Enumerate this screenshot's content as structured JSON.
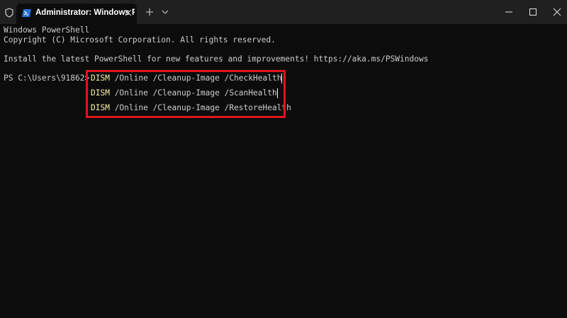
{
  "titlebar": {
    "tab_title": "Administrator: Windows PowerShell",
    "icons": [
      "shield-icon",
      "powershell-icon",
      "close-icon",
      "plus-icon",
      "chevron-down-icon",
      "minimize-icon",
      "maximize-icon",
      "close-icon"
    ]
  },
  "terminal": {
    "lines": [
      "Windows PowerShell",
      "Copyright (C) Microsoft Corporation. All rights reserved.",
      "",
      "Install the latest PowerShell for new features and improvements! https://aka.ms/PSWindows"
    ],
    "prompt": "PS C:\\Users\\91862>",
    "commands": [
      {
        "keyword": "DISM",
        "args": " /Online /Cleanup-Image /CheckHealth"
      },
      {
        "keyword": "DISM",
        "args": " /Online /Cleanup-Image /ScanHealth"
      },
      {
        "keyword": "DISM",
        "args": " /Online /Cleanup-Image /RestoreHealth"
      }
    ]
  },
  "colors": {
    "background": "#0c0c0c",
    "titlebar": "#202020",
    "text": "#cccccc",
    "keyword": "#f9f1a5",
    "highlight_border": "#e0141c"
  }
}
